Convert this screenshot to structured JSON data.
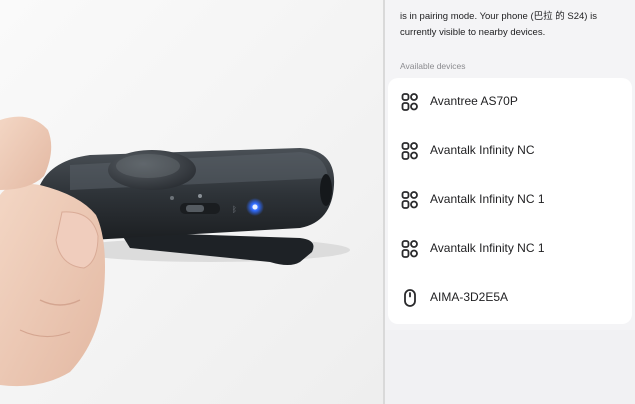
{
  "panel": {
    "intro_text": "is in pairing mode. Your phone (巴拉 的 S24) is currently visible to nearby devices.",
    "section_label": "Available devices",
    "devices": [
      {
        "label": "Avantree AS70P",
        "icon": "headset-icon"
      },
      {
        "label": "Avantalk Infinity NC",
        "icon": "headset-icon"
      },
      {
        "label": "Avantalk Infinity NC 1",
        "icon": "headset-icon"
      },
      {
        "label": "Avantalk Infinity NC 1",
        "icon": "headset-icon"
      },
      {
        "label": "AIMA-3D2E5A",
        "icon": "mouse-icon"
      }
    ]
  },
  "colors": {
    "panel_bg": "#f4f4f6",
    "list_bg": "#ffffff",
    "text": "#1f1f21",
    "muted_text": "#8b8b8f",
    "led": "#2f6bff"
  }
}
